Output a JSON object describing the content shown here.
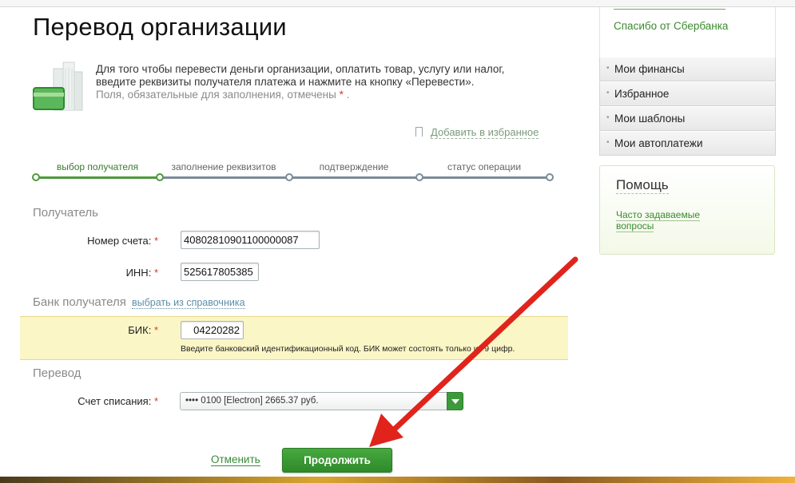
{
  "page": {
    "title": "Перевод организации",
    "intro_line1": "Для того чтобы перевести деньги организации, оплатить товар, услугу или налог,",
    "intro_line2": "введите реквизиты получателя платежа и нажмите на кнопку «Перевести».",
    "required_note": "Поля, обязательные для заполнения, отмечены",
    "required_mark": "*",
    "required_period": "."
  },
  "favorites": {
    "label": "Добавить в избранное",
    "icon": "bookmark-icon"
  },
  "steps": [
    {
      "label": "выбор получателя",
      "state": "active"
    },
    {
      "label": "заполнение реквизитов",
      "state": "pending"
    },
    {
      "label": "подтверждение",
      "state": "pending"
    },
    {
      "label": "статус операции",
      "state": "pending"
    }
  ],
  "recipient": {
    "section_title": "Получатель",
    "account_label": "Номер счета:",
    "account_value": "40802810901100000087",
    "inn_label": "ИНН:",
    "inn_value": "525617805385"
  },
  "bank": {
    "section_title": "Банк получателя",
    "directory_link": "выбрать из справочника",
    "bik_label": "БИК:",
    "bik_value": "04220282",
    "bik_hint": "Введите банковский идентификационный код. БИК может состоять только из 9 цифр."
  },
  "transfer": {
    "section_title": "Перевод",
    "debit_label": "Счет списания:",
    "debit_selected": "•••• 0100 [Electron] 2665.37 руб."
  },
  "actions": {
    "cancel": "Отменить",
    "continue": "Продолжить"
  },
  "sidebar": {
    "thanks_link": "Спасибо от Сбербанка",
    "menu": [
      "Мои финансы",
      "Избранное",
      "Мои шаблоны",
      "Мои автоплатежи"
    ],
    "help": {
      "title": "Помощь",
      "faq_link": "Часто задаваемые вопросы"
    }
  },
  "colors": {
    "brand_green": "#2f8a2b",
    "highlight_yellow": "#fbf6c6",
    "annotation_red": "#e0241c"
  }
}
